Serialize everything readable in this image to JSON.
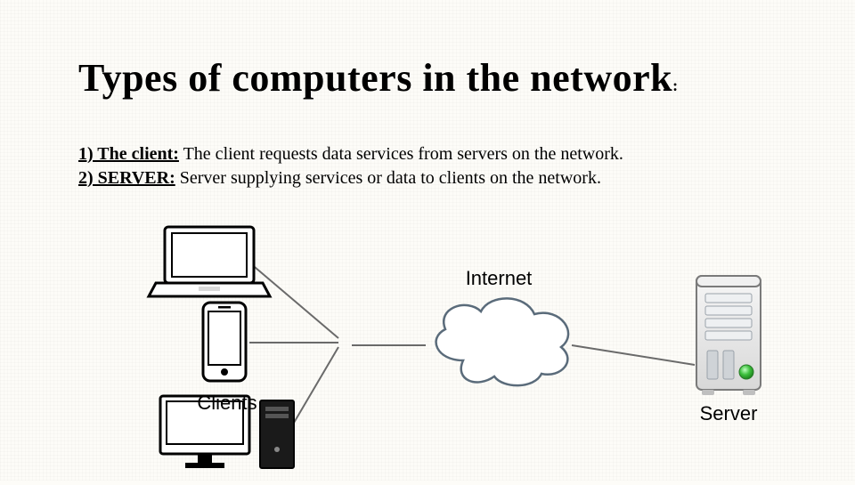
{
  "title_main": "Types of computers in the network",
  "title_colon": ":",
  "bullets": [
    {
      "lead": "1) The client:",
      "rest": " The client requests data services from servers on the network."
    },
    {
      "lead": "2) SERVER:",
      "rest": " Server supplying services or data to clients on the network."
    }
  ],
  "diagram": {
    "label_clients": "Clients",
    "label_internet": "Internet",
    "label_server": "Server"
  }
}
